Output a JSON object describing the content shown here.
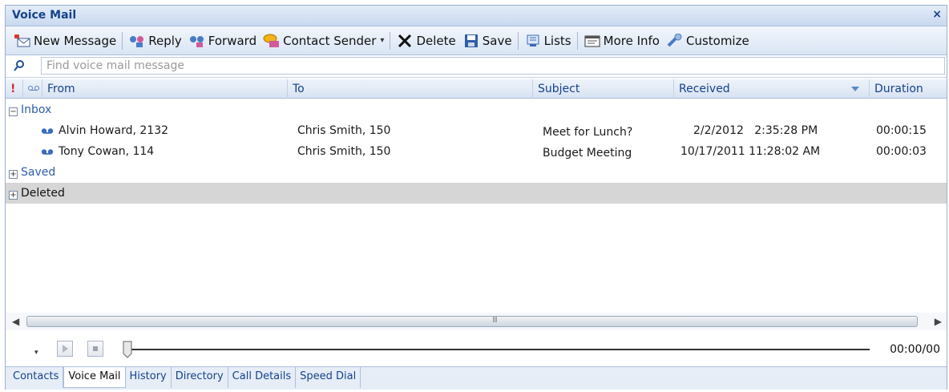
{
  "window": {
    "title": "Voice Mail",
    "close_glyph": "×"
  },
  "toolbar": {
    "new_message": "New Message",
    "reply": "Reply",
    "forward": "Forward",
    "contact_sender": "Contact Sender",
    "delete": "Delete",
    "save": "Save",
    "lists": "Lists",
    "more_info": "More Info",
    "customize": "Customize"
  },
  "search": {
    "placeholder": "Find voice mail message"
  },
  "columns": {
    "importance": "!",
    "from": "From",
    "to": "To",
    "subject": "Subject",
    "received": "Received",
    "duration": "Duration"
  },
  "groups": {
    "inbox": "Inbox",
    "saved": "Saved",
    "deleted": "Deleted"
  },
  "messages": [
    {
      "from": "Alvin Howard, 2132",
      "to": "Chris Smith, 150",
      "subject": "Meet for Lunch?",
      "received": "2/2/2012   2:35:28 PM",
      "duration": "00:00:15"
    },
    {
      "from": "Tony Cowan, 114",
      "to": "Chris Smith, 150",
      "subject": "Budget Meeting",
      "received": "10/17/2011 11:28:02 AM",
      "duration": "00:00:03"
    }
  ],
  "player": {
    "time": "00:00/00",
    "progress": 0
  },
  "scroll": {
    "grip": "III"
  },
  "tabs": [
    "Contacts",
    "Voice Mail",
    "History",
    "Directory",
    "Call Details",
    "Speed Dial"
  ],
  "active_tab": "Voice Mail",
  "colors": {
    "title": "#15428b",
    "group": "#2e5ea8",
    "selected_group": "#d6d6d6"
  }
}
